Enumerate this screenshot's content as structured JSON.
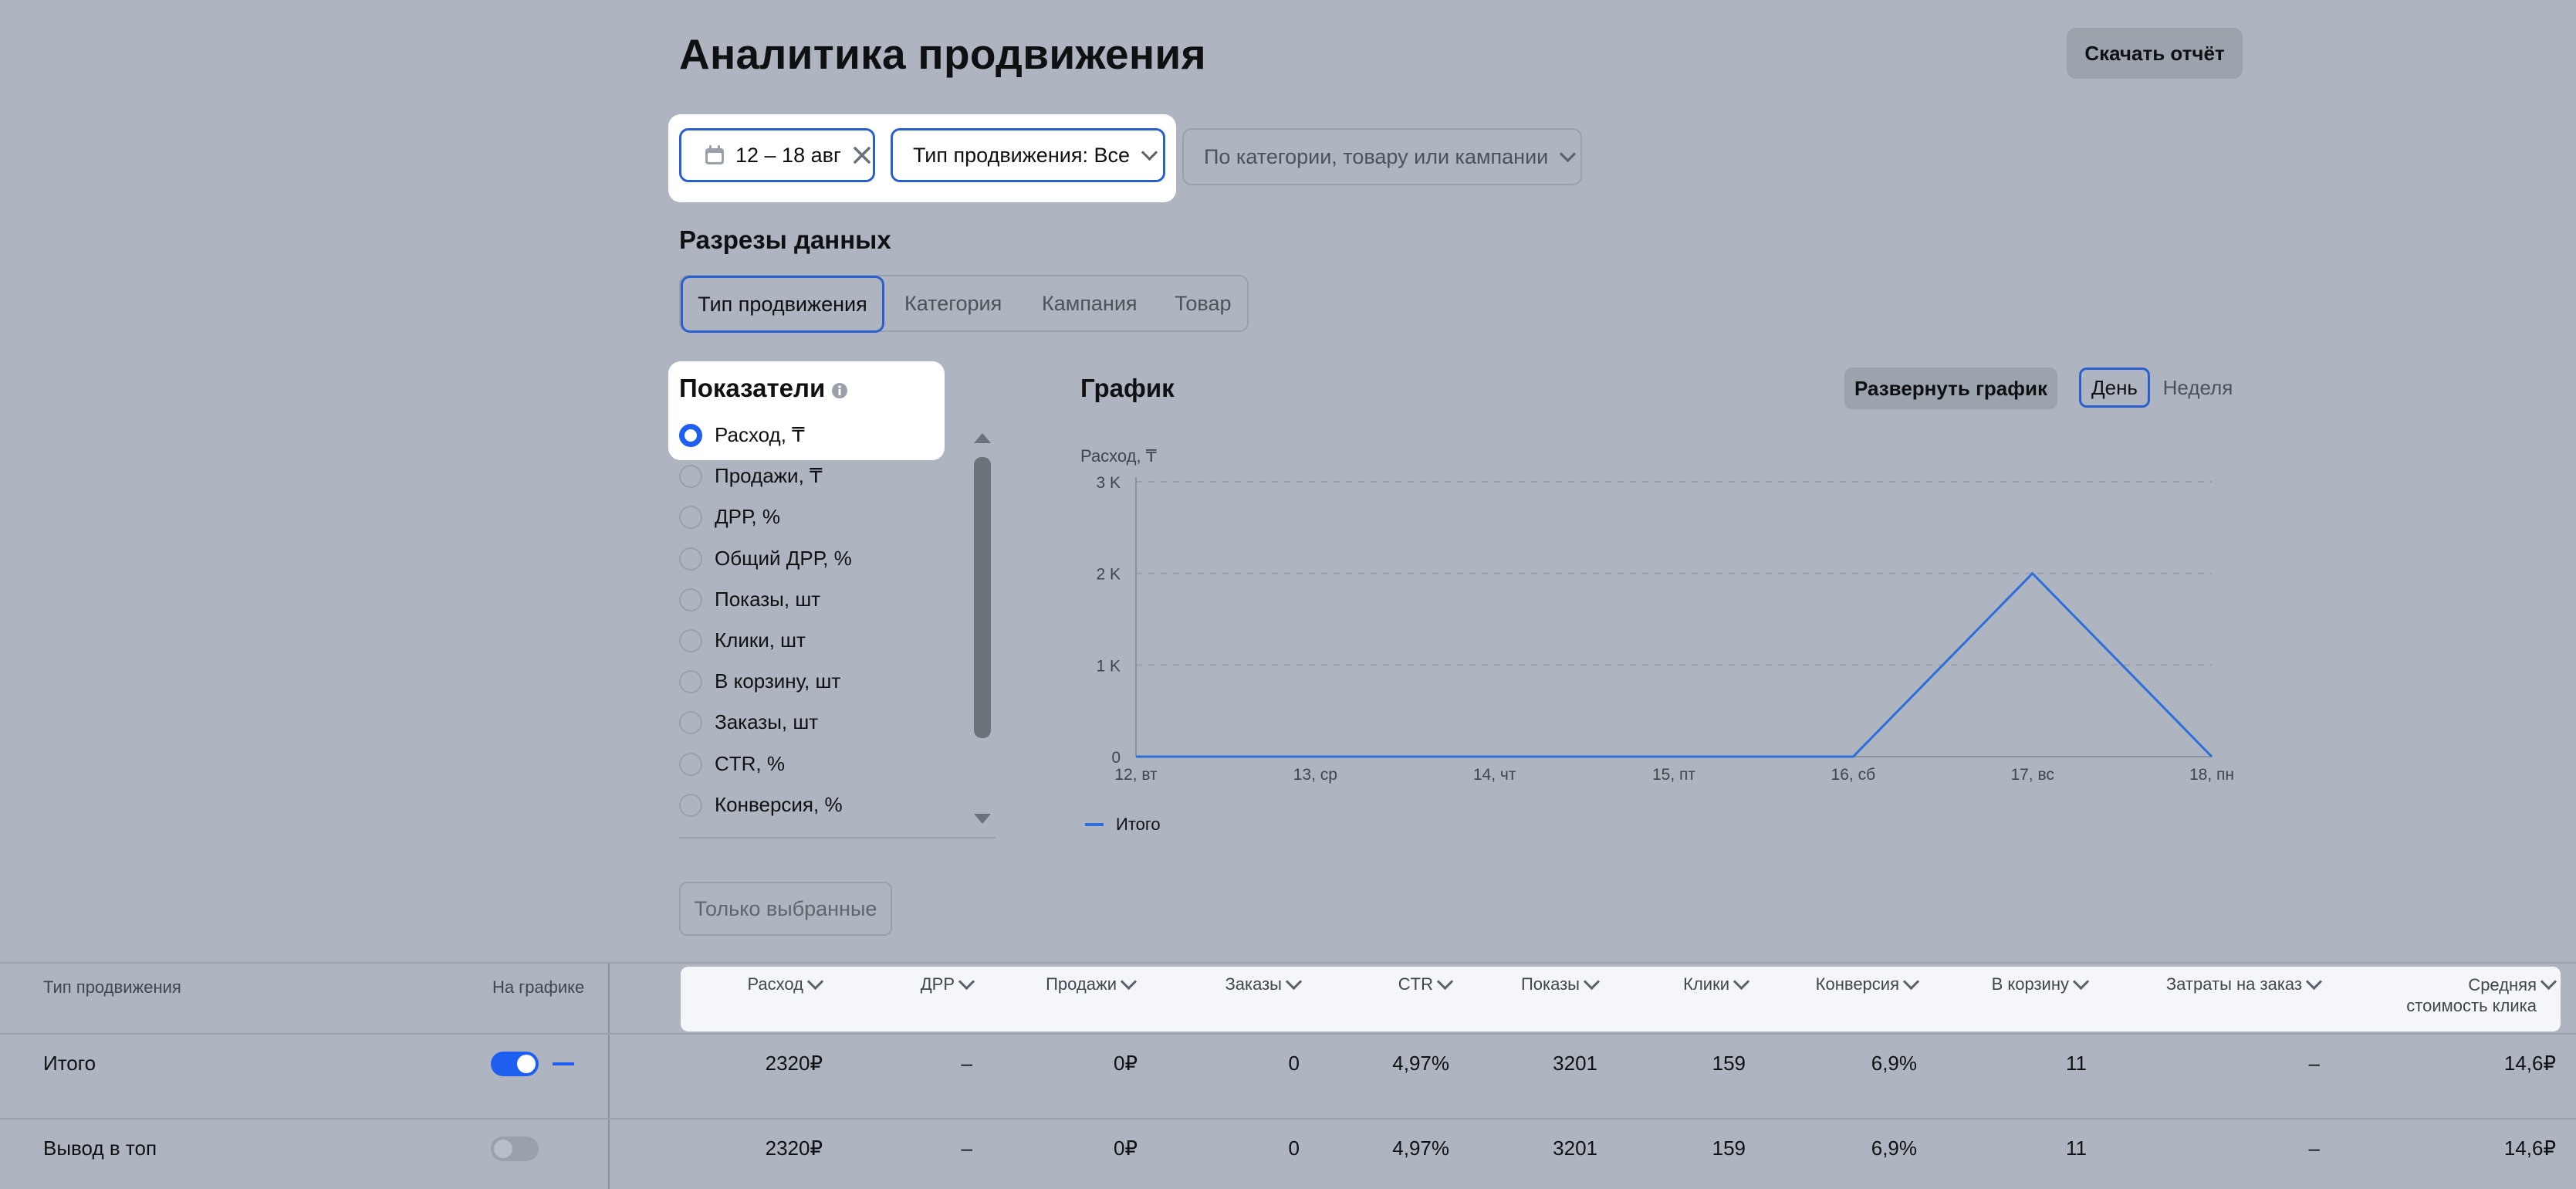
{
  "title": "Аналитика продвижения",
  "download_label": "Скачать отчёт",
  "filters": {
    "date": "12 – 18 авг",
    "promo_type": "Тип продвижения: Все",
    "dimension_placeholder": "По категории, товару или кампании"
  },
  "slices": {
    "heading": "Разрезы данных",
    "tabs": [
      "Тип продвижения",
      "Категория",
      "Кампания",
      "Товар"
    ],
    "active": 0
  },
  "metrics": {
    "heading": "Показатели",
    "items": [
      "Расход, ₸",
      "Продажи, ₸",
      "ДРР, %",
      "Общий ДРР, %",
      "Показы, шт",
      "Клики, шт",
      "В корзину, шт",
      "Заказы, шт",
      "CTR, %",
      "Конверсия, %"
    ],
    "selected": 0,
    "only_selected_label": "Только выбранные"
  },
  "chart_panel": {
    "heading": "График",
    "expand_label": "Развернуть график",
    "period_day": "День",
    "period_week": "Неделя",
    "active_period": "day"
  },
  "chart_data": {
    "type": "line",
    "ylabel": "Расход, ₸",
    "ylim": [
      0,
      3000
    ],
    "y_ticks": [
      "0",
      "1 K",
      "2 K",
      "3 K"
    ],
    "categories": [
      "12, вт",
      "13, ср",
      "14, чт",
      "15, пт",
      "16, сб",
      "17, вс",
      "18, пн"
    ],
    "series": [
      {
        "name": "Итого",
        "values": [
          0,
          0,
          0,
          0,
          0,
          2000,
          0
        ],
        "color": "#2a6fdb"
      }
    ],
    "grid": true,
    "legend_position": "bottom-left"
  },
  "table": {
    "left_headers": {
      "type": "Тип продвижения",
      "on_chart": "На графике"
    },
    "columns": [
      "Расход",
      "ДРР",
      "Продажи",
      "Заказы",
      "CTR",
      "Показы",
      "Клики",
      "Конверсия",
      "В корзину",
      "Затраты на заказ",
      "Средняя стоимость клика"
    ],
    "rows": [
      {
        "name": "Итого",
        "on_chart": true,
        "values": [
          "2320₽",
          "–",
          "0₽",
          "0",
          "4,97%",
          "3201",
          "159",
          "6,9%",
          "11",
          "–",
          "14,6₽"
        ]
      },
      {
        "name": "Вывод в топ",
        "on_chart": false,
        "values": [
          "2320₽",
          "–",
          "0₽",
          "0",
          "4,97%",
          "3201",
          "159",
          "6,9%",
          "11",
          "–",
          "14,6₽"
        ]
      }
    ]
  },
  "colors": {
    "accent": "#1f5ff0",
    "background": "#aeb5c0"
  }
}
